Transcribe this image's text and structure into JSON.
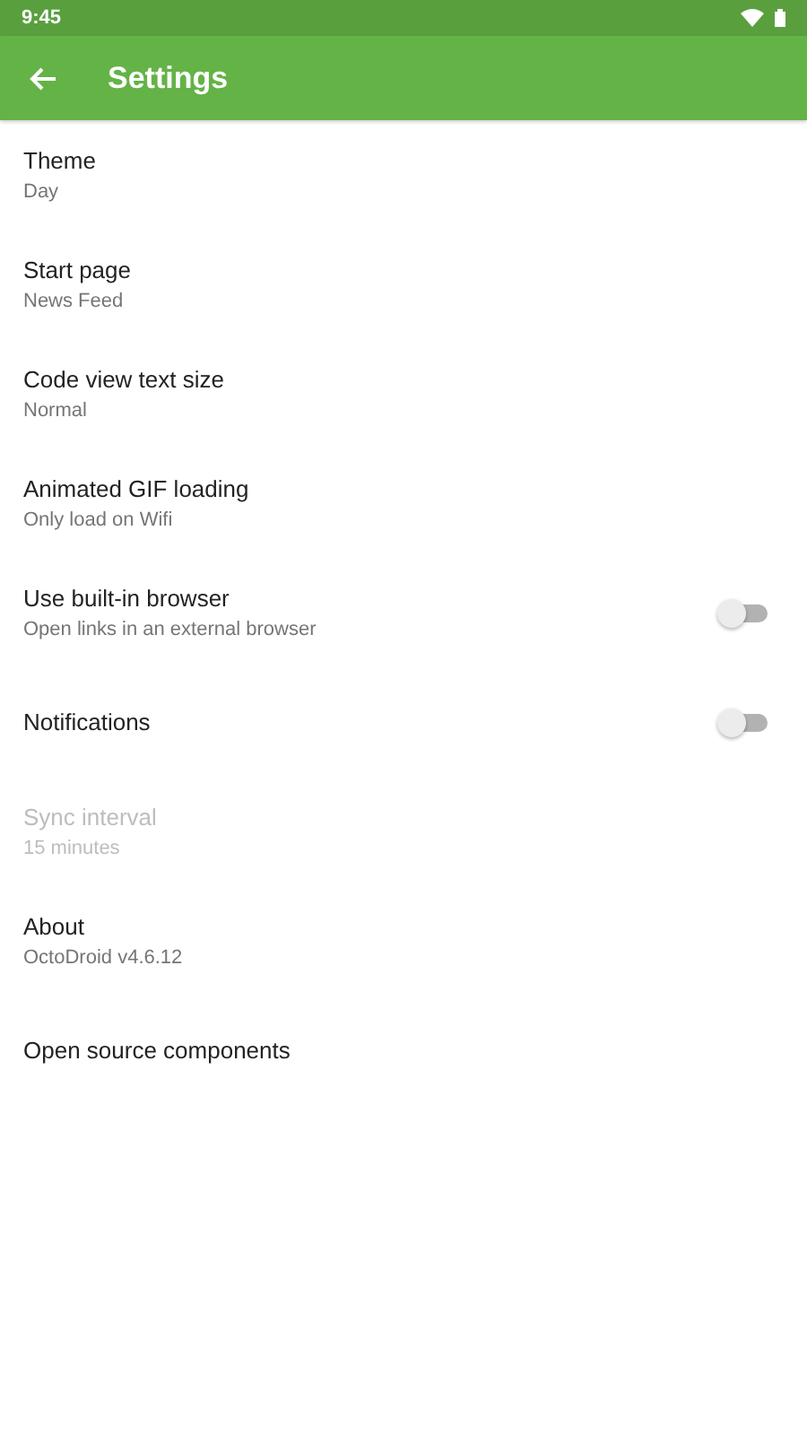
{
  "status_bar": {
    "time": "9:45"
  },
  "toolbar": {
    "title": "Settings"
  },
  "items": [
    {
      "kind": "text",
      "title": "Theme",
      "summary": "Day",
      "disabled": false
    },
    {
      "kind": "text",
      "title": "Start page",
      "summary": "News Feed",
      "disabled": false
    },
    {
      "kind": "text",
      "title": "Code view text size",
      "summary": "Normal",
      "disabled": false
    },
    {
      "kind": "text",
      "title": "Animated GIF loading",
      "summary": "Only load on Wifi",
      "disabled": false
    },
    {
      "kind": "switch",
      "title": "Use built-in browser",
      "summary": "Open links in an external browser",
      "disabled": false,
      "on": false
    },
    {
      "kind": "switch",
      "title": "Notifications",
      "disabled": false,
      "on": false
    },
    {
      "kind": "text",
      "title": "Sync interval",
      "summary": "15 minutes",
      "disabled": true
    },
    {
      "kind": "text",
      "title": "About",
      "summary": "OctoDroid v4.6.12",
      "disabled": false
    },
    {
      "kind": "text",
      "title": "Open source components",
      "disabled": false
    }
  ]
}
